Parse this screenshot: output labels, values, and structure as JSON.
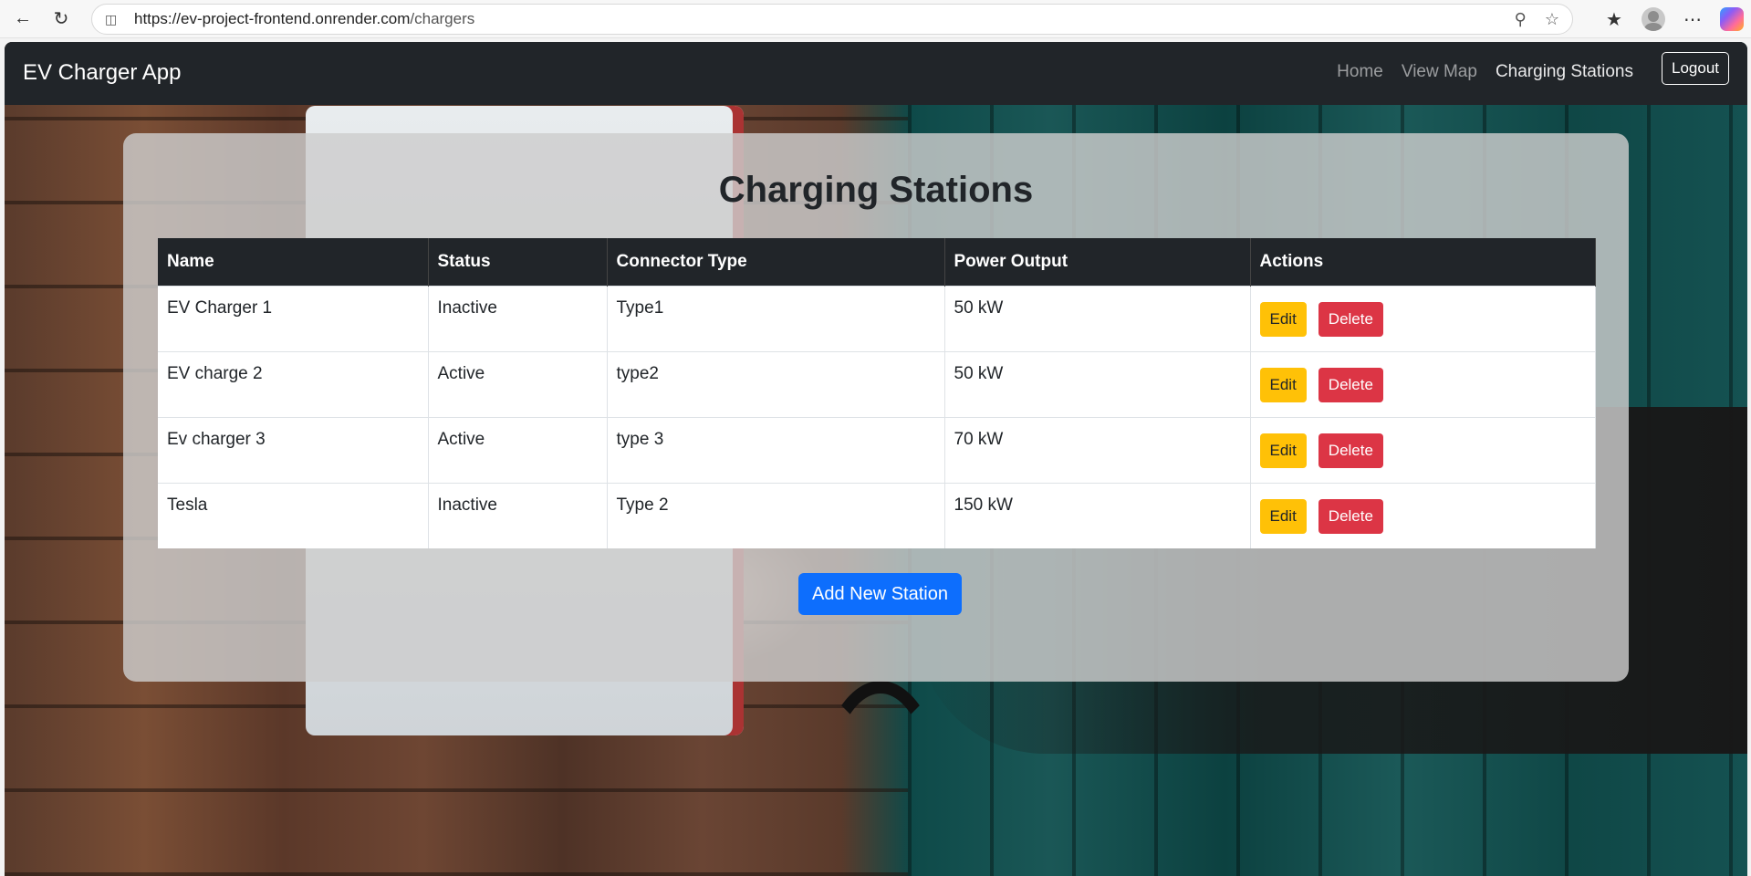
{
  "browser": {
    "url_host": "https://ev-project-frontend.onrender.com",
    "url_path": "/chargers"
  },
  "navbar": {
    "brand": "EV Charger App",
    "links": [
      {
        "label": "Home"
      },
      {
        "label": "View Map"
      },
      {
        "label": "Charging Stations"
      }
    ],
    "logout_label": "Logout"
  },
  "main": {
    "title": "Charging Stations",
    "table": {
      "headers": [
        "Name",
        "Status",
        "Connector Type",
        "Power Output",
        "Actions"
      ],
      "rows": [
        {
          "name": "EV Charger 1",
          "status": "Inactive",
          "connector": "Type1",
          "power": "50 kW"
        },
        {
          "name": "EV charge 2",
          "status": "Active",
          "connector": "type2",
          "power": "50 kW"
        },
        {
          "name": "Ev charger 3",
          "status": "Active",
          "connector": "type 3",
          "power": "70 kW"
        },
        {
          "name": "Tesla",
          "status": "Inactive",
          "connector": "Type 2",
          "power": "150 kW"
        }
      ],
      "edit_label": "Edit",
      "delete_label": "Delete"
    },
    "add_button_label": "Add New Station"
  },
  "colors": {
    "navbar_bg": "#212529",
    "edit_button": "#ffc107",
    "delete_button": "#dc3545",
    "primary_button": "#0d6efd"
  }
}
